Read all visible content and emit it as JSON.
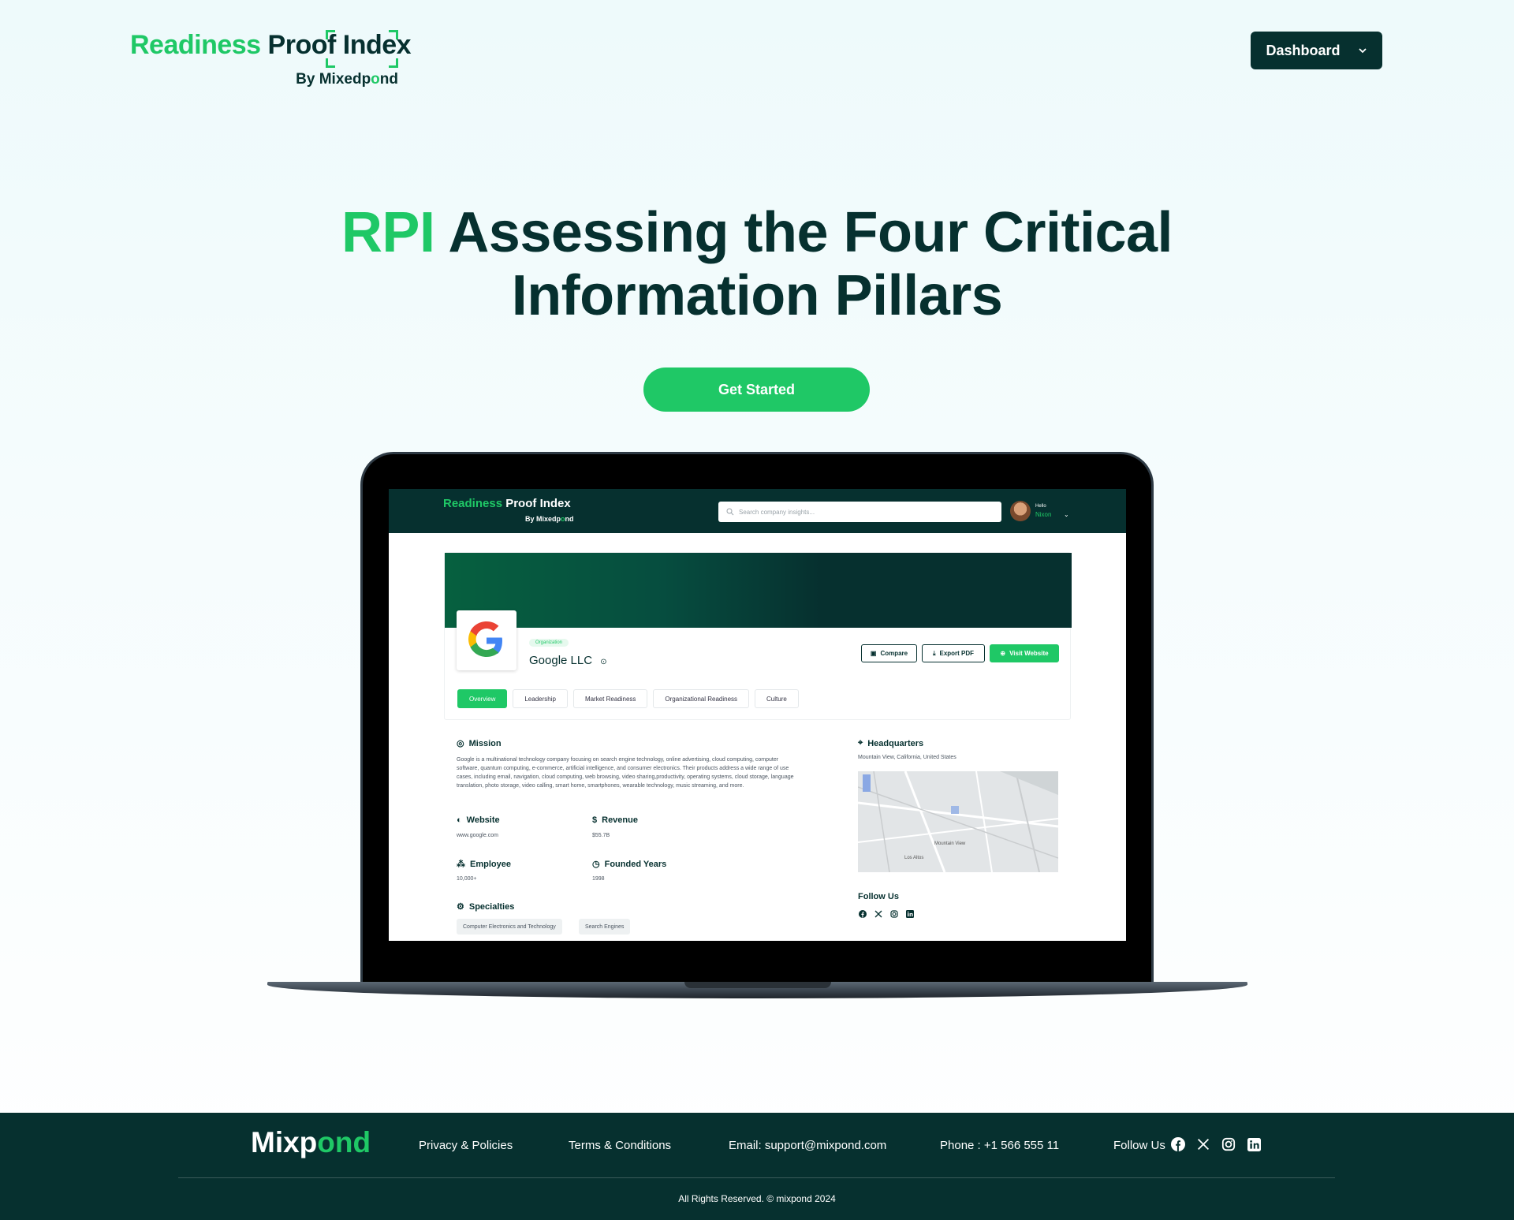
{
  "header": {
    "logo": {
      "word1": "Readiness",
      "word2": "Proof",
      "word3": "Index",
      "by": "By",
      "sub1": "Mixedp",
      "sub2": "o",
      "sub3": "nd"
    },
    "dashboard_label": "Dashboard"
  },
  "hero": {
    "highlight": "RPI",
    "line1": "Assessing the Four Critical",
    "line2": "Information Pillars",
    "cta_label": "Get Started"
  },
  "app": {
    "search_placeholder": "Search company insights...",
    "user_greeting": "Hello",
    "user_name": "Nixon",
    "org_tag": "Organization",
    "org_name": "Google LLC",
    "buttons": {
      "compare": "Compare",
      "export": "Export PDF",
      "visit": "Visit Website"
    },
    "tabs": [
      "Overview",
      "Leadership",
      "Market Readiness",
      "Organizational Readiness",
      "Culture"
    ],
    "mission_title": "Mission",
    "mission_text": "Google is a multinational technology company focusing on search engine technology, online advertising, cloud computing, computer software, quantum computing, e-commerce, artificial intelligence, and consumer electronics. Their products address a wide range of use cases, including email, navigation, cloud computing, web browsing, video sharing,productivity, operating systems, cloud storage, language translation, photo storage, video calling, smart home, smartphones, wearable technology, music streaming, and more.",
    "website_title": "Website",
    "website_value": "www.google.com",
    "revenue_title": "Revenue",
    "revenue_value": "$55.7B",
    "employee_title": "Employee",
    "employee_value": "10,000+",
    "founded_title": "Founded Years",
    "founded_value": "1998",
    "specialties_title": "Specialties",
    "specialties": [
      "Computer Electronics and Technology",
      "Search Engines"
    ],
    "hq_title": "Headquarters",
    "hq_value": "Mountain View, California, United States",
    "map_labels": [
      "Mountain View",
      "Los Altos"
    ],
    "follow_title": "Follow Us"
  },
  "footer": {
    "logo": {
      "part1": "Mixp",
      "part2": "o",
      "part3": "nd"
    },
    "privacy": "Privacy & Policies",
    "terms": "Terms & Conditions",
    "email": "Email: support@mixpond.com",
    "phone": "Phone : +1 566 555 11",
    "follow": "Follow Us",
    "copyright": "All Rights Reserved. © mixpond 2024"
  },
  "colors": {
    "brand_green": "#1fc866",
    "dark_teal": "#06302f"
  }
}
